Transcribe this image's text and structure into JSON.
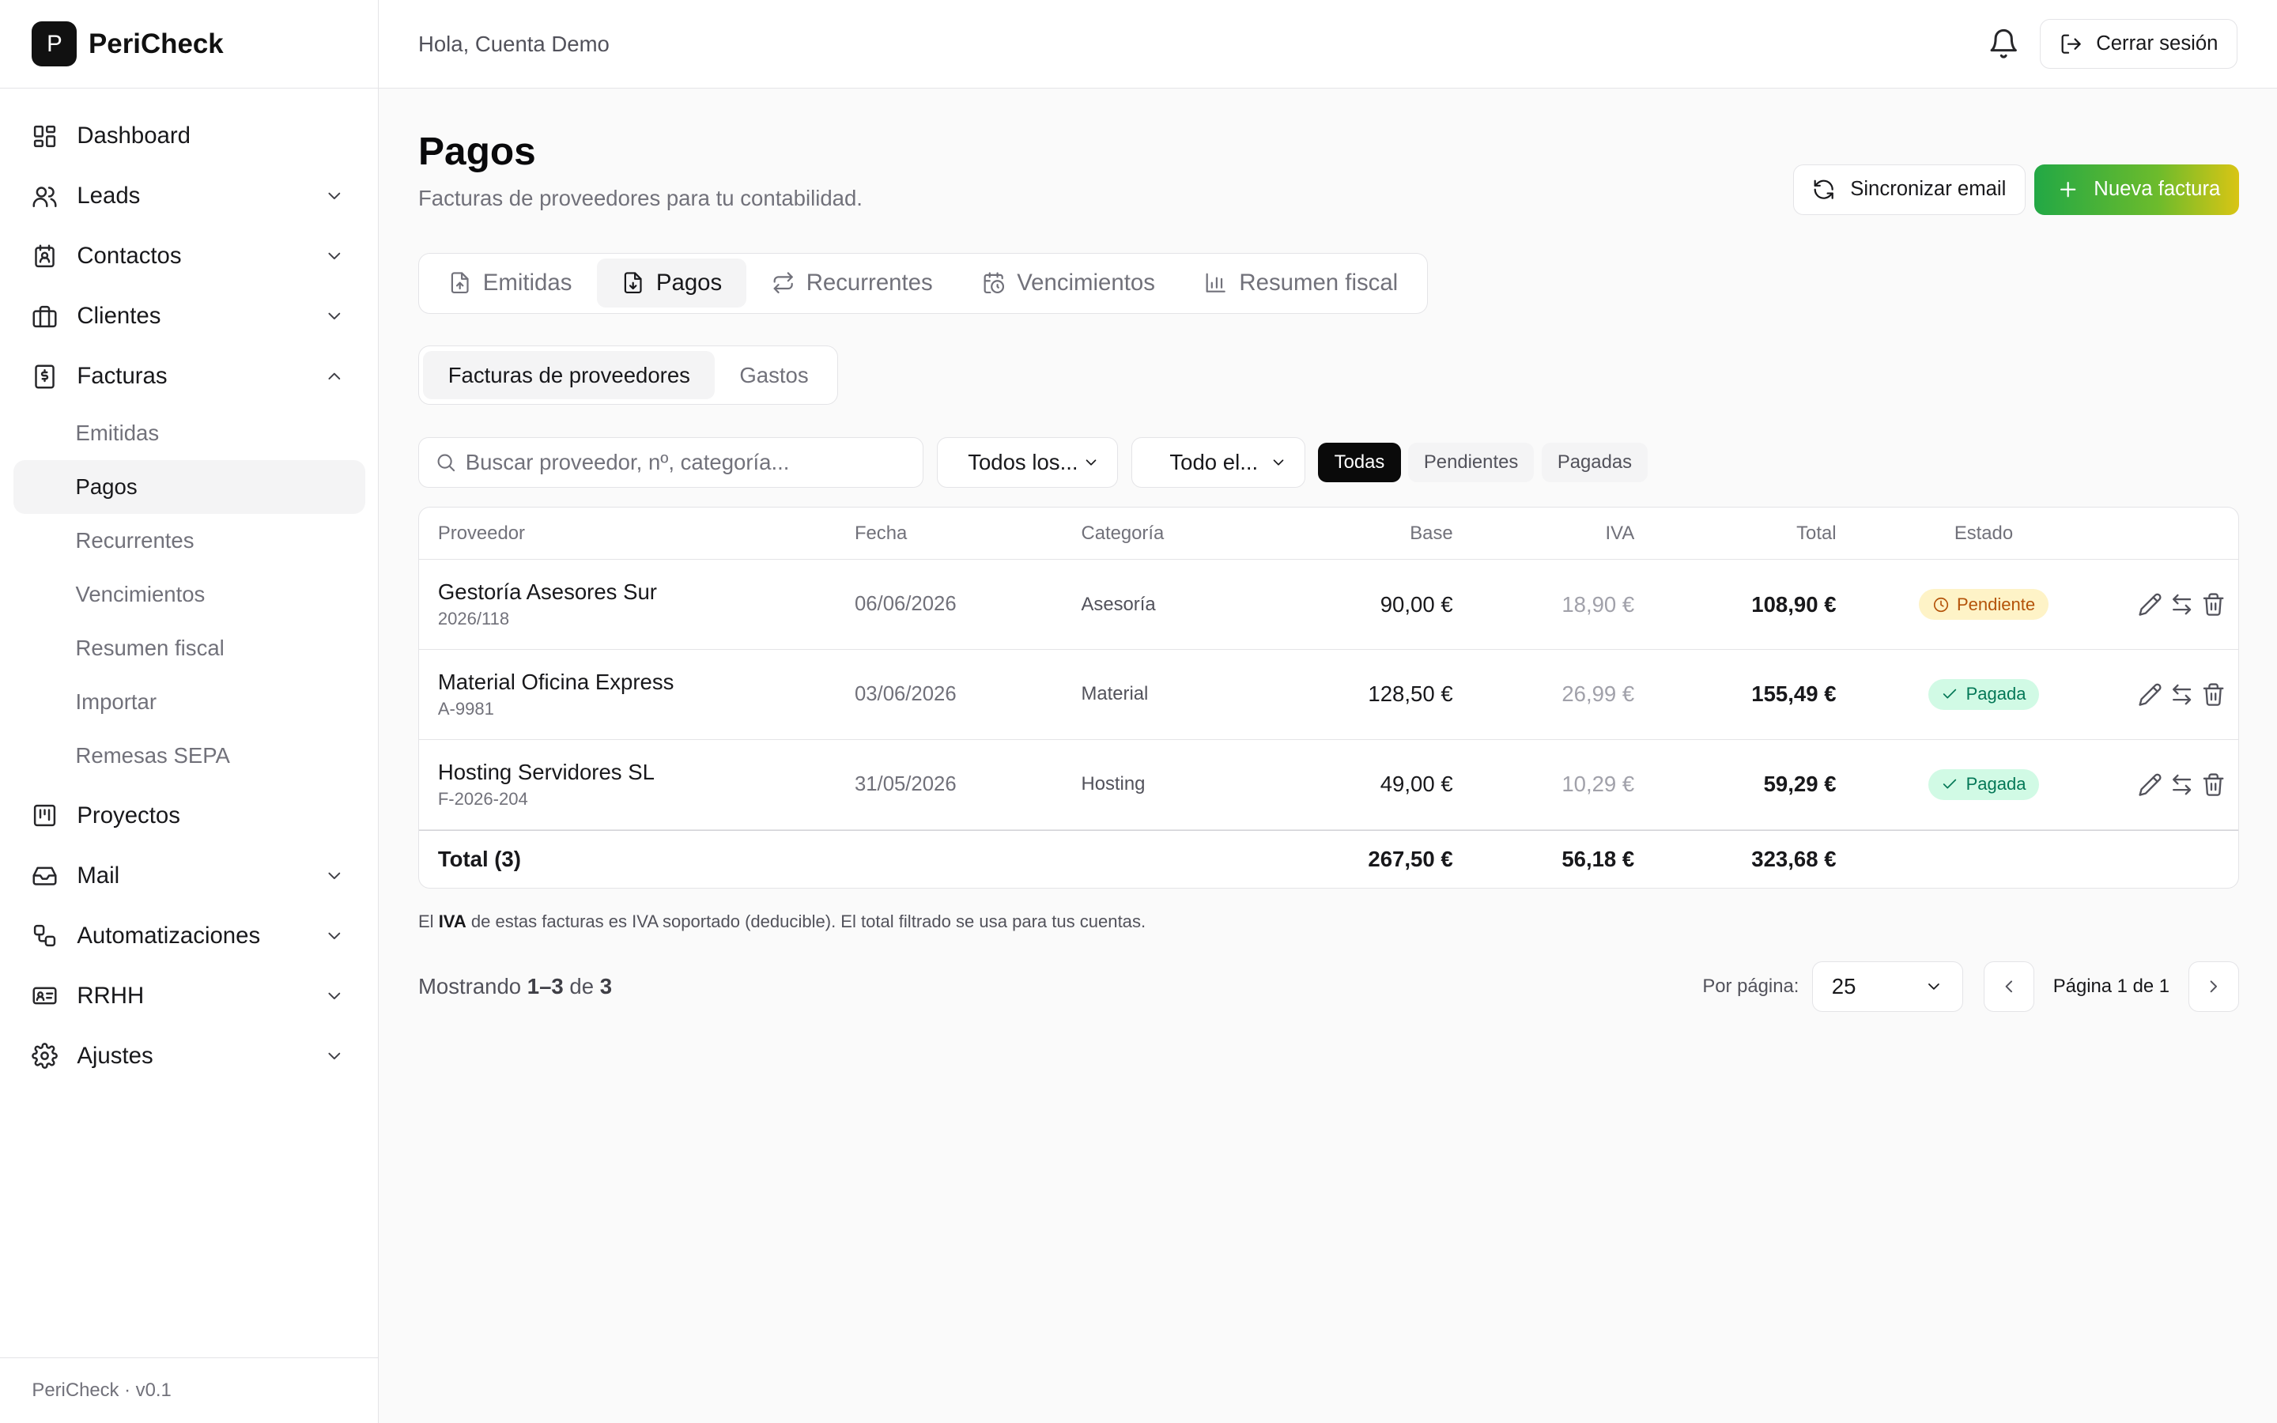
{
  "brand": {
    "logo_letter": "P",
    "name": "PeriCheck"
  },
  "sidebar": {
    "items": [
      {
        "label": "Dashboard",
        "icon": "grid-icon"
      },
      {
        "label": "Leads",
        "icon": "users-icon"
      },
      {
        "label": "Contactos",
        "icon": "contact-book-icon"
      },
      {
        "label": "Clientes",
        "icon": "briefcase-icon"
      },
      {
        "label": "Facturas",
        "icon": "invoice-icon"
      },
      {
        "label": "Proyectos",
        "icon": "kanban-icon"
      },
      {
        "label": "Mail",
        "icon": "inbox-icon"
      },
      {
        "label": "Automatizaciones",
        "icon": "workflow-icon"
      },
      {
        "label": "RRHH",
        "icon": "id-card-icon"
      },
      {
        "label": "Ajustes",
        "icon": "gear-icon"
      }
    ],
    "facturas_sub": [
      "Emitidas",
      "Pagos",
      "Recurrentes",
      "Vencimientos",
      "Resumen fiscal",
      "Importar",
      "Remesas SEPA"
    ],
    "footer": "PeriCheck · v0.1"
  },
  "topbar": {
    "greeting": "Hola, Cuenta Demo",
    "logout_label": "Cerrar sesión"
  },
  "page": {
    "title": "Pagos",
    "subtitle": "Facturas de proveedores para tu contabilidad.",
    "sync_label": "Sincronizar email",
    "new_label": "Nueva factura"
  },
  "tabs": [
    "Emitidas",
    "Pagos",
    "Recurrentes",
    "Vencimientos",
    "Resumen fiscal"
  ],
  "segments": [
    "Facturas de proveedores",
    "Gastos"
  ],
  "filters": {
    "search_placeholder": "Buscar proveedor, nº, categoría...",
    "select1": "Todos los...",
    "select2": "Todo el...",
    "pills": [
      "Todas",
      "Pendientes",
      "Pagadas"
    ]
  },
  "table": {
    "headers": [
      "Proveedor",
      "Fecha",
      "Categoría",
      "Base",
      "IVA",
      "Total",
      "Estado"
    ],
    "rows": [
      {
        "proveedor": "Gestoría Asesores Sur",
        "numero": "2026/118",
        "fecha": "06/06/2026",
        "categoria": "Asesoría",
        "base": "90,00 €",
        "iva": "18,90 €",
        "total": "108,90 €",
        "estado": "Pendiente"
      },
      {
        "proveedor": "Material Oficina Express",
        "numero": "A-9981",
        "fecha": "03/06/2026",
        "categoria": "Material",
        "base": "128,50 €",
        "iva": "26,99 €",
        "total": "155,49 €",
        "estado": "Pagada"
      },
      {
        "proveedor": "Hosting Servidores SL",
        "numero": "F-2026-204",
        "fecha": "31/05/2026",
        "categoria": "Hosting",
        "base": "49,00 €",
        "iva": "10,29 €",
        "total": "59,29 €",
        "estado": "Pagada"
      }
    ],
    "totals": {
      "label": "Total (3)",
      "base": "267,50 €",
      "iva": "56,18 €",
      "total": "323,68 €"
    }
  },
  "note": {
    "pre": "El ",
    "bold": "IVA",
    "post": " de estas facturas es IVA soportado (deducible). El total filtrado se usa para tus cuentas."
  },
  "pager": {
    "showing_pre": "Mostrando ",
    "showing_range": "1–3",
    "showing_mid": " de ",
    "showing_count": "3",
    "per_page_label": "Por página:",
    "per_page_value": "25",
    "page_label": "Página 1 de 1"
  },
  "colors": {
    "accent_start": "#22a845",
    "accent_end": "#d9c514",
    "pending_bg": "#fef3c7",
    "pending_fg": "#b45309",
    "paid_bg": "#d1fae5",
    "paid_fg": "#047857"
  }
}
